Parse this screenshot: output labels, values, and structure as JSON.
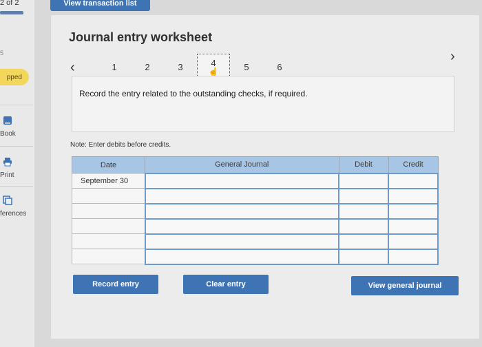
{
  "progress": {
    "text": "2 of 2",
    "fraction": 1.0
  },
  "rail": {
    "small_num": "5",
    "skipped_label": "pped",
    "tools": [
      {
        "label": "Book",
        "icon": "book-icon"
      },
      {
        "label": "Print",
        "icon": "print-icon"
      },
      {
        "label": "ferences",
        "icon": "references-icon"
      }
    ]
  },
  "topbar": {
    "view_list_label": "View transaction list"
  },
  "worksheet": {
    "title": "Journal entry worksheet",
    "steps": [
      "1",
      "2",
      "3",
      "4",
      "5",
      "6"
    ],
    "active_step": "4",
    "instruction": "Record the entry related to the outstanding checks, if required.",
    "note": "Note: Enter debits before credits."
  },
  "table": {
    "headers": {
      "date": "Date",
      "journal": "General Journal",
      "debit": "Debit",
      "credit": "Credit"
    },
    "rows": [
      {
        "date": "September 30"
      },
      {
        "date": ""
      },
      {
        "date": ""
      },
      {
        "date": ""
      },
      {
        "date": ""
      },
      {
        "date": ""
      }
    ]
  },
  "buttons": {
    "record": "Record entry",
    "clear": "Clear entry",
    "view_journal": "View general journal"
  },
  "colors": {
    "accent": "#3e74b3",
    "header": "#a7c6e6",
    "badge": "#f3d75c"
  }
}
